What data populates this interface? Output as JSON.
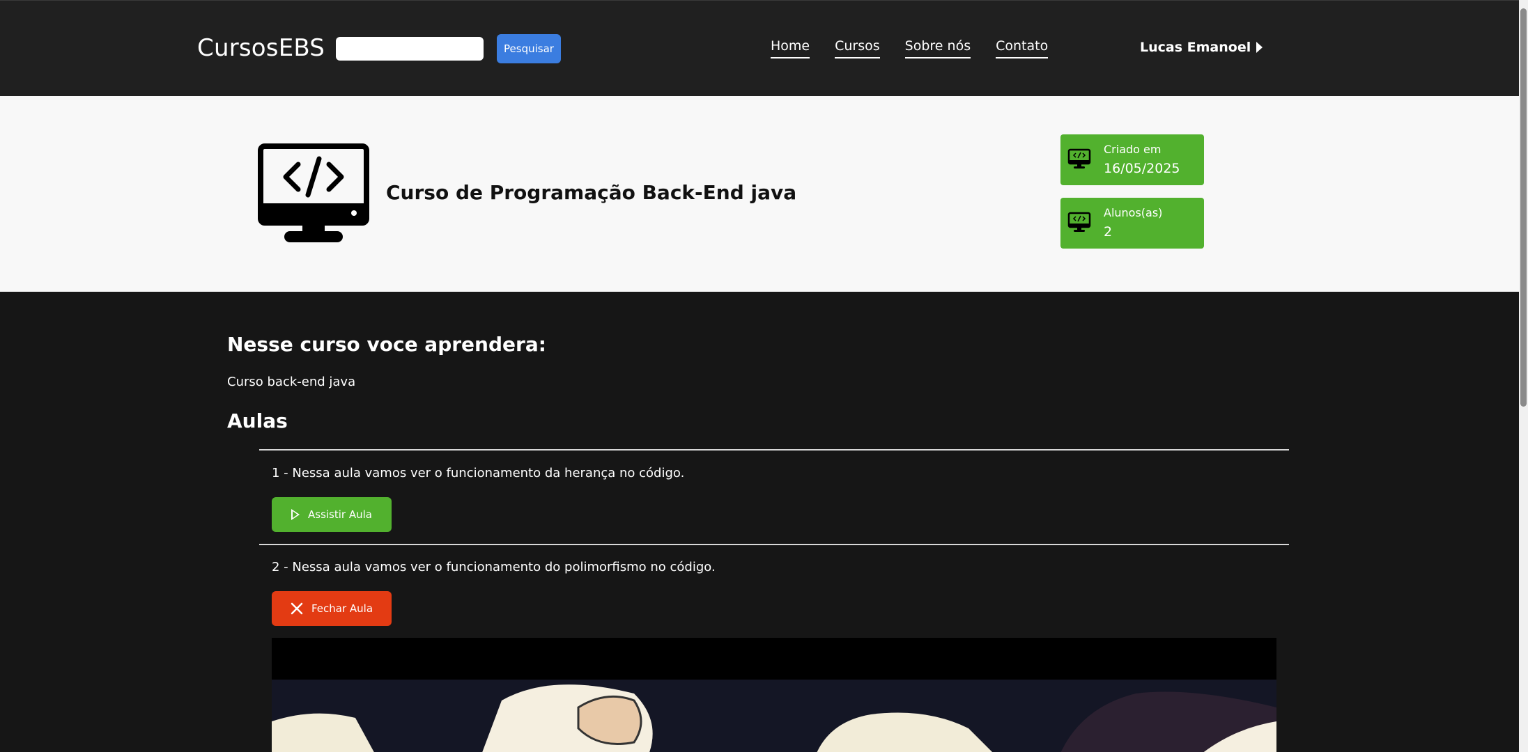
{
  "header": {
    "brand": "CursosEBS",
    "search_placeholder": "",
    "search_button": "Pesquisar",
    "nav": [
      "Home",
      "Cursos",
      "Sobre nós",
      "Contato"
    ],
    "user_name": "Lucas Emanoel"
  },
  "hero": {
    "course_title": "Curso de Programação Back-End java",
    "stats": [
      {
        "label": "Criado em",
        "value": "16/05/2025"
      },
      {
        "label": "Alunos(as)",
        "value": "2"
      }
    ]
  },
  "content": {
    "learn_title": "Nesse curso voce aprendera:",
    "learn_desc": "Curso back-end java",
    "aulas_title": "Aulas",
    "lessons": [
      {
        "text": "1 - Nessa aula vamos ver o funcionamento da herança no código.",
        "button": "Assistir Aula"
      },
      {
        "text": "2 - Nessa aula vamos ver o funcionamento do polimorfismo no código.",
        "button": "Fechar Aula"
      }
    ]
  },
  "colors": {
    "header_bg": "#202020",
    "hero_bg": "#f8f8f8",
    "body_bg": "#161616",
    "accent_blue": "#3b7de0",
    "green": "#52b12e",
    "red": "#e33b13"
  },
  "icons": {
    "hero": "monitor-code-icon",
    "stat": "monitor-code-icon",
    "play": "play-icon",
    "close": "close-icon",
    "user_caret": "caret-right-icon"
  }
}
